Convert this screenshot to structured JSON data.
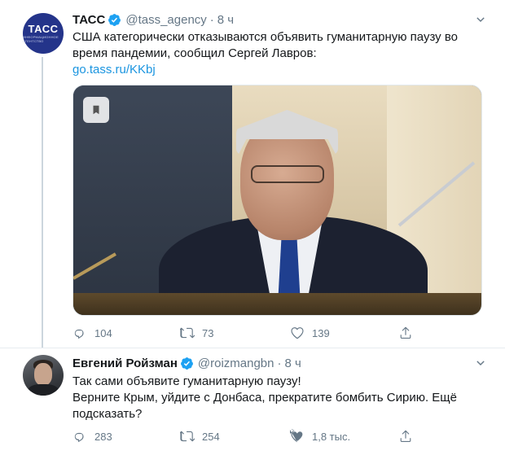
{
  "tweets": [
    {
      "author_name": "ТАСС",
      "handle": "@tass_agency",
      "separator": "·",
      "time": "8 ч",
      "avatar_text": "ТАСС",
      "avatar_subtext": "ИНФОРМАЦИОННОЕ АГЕНТСТВО",
      "text_lines": [
        "США категорически отказываются объявить гуманитарную паузу во",
        "время пандемии, сообщил Сергей Лавров:"
      ],
      "link": "go.tass.ru/KKbj",
      "replies": "104",
      "retweets": "73",
      "likes": "139"
    },
    {
      "author_name": "Евгений Ройзман",
      "handle": "@roizmangbn",
      "separator": "·",
      "time": "8 ч",
      "text_lines": [
        "Так сами объявите гуманитарную паузу!",
        "Верните Крым, уйдите с Донбаса, прекратите бомбить Сирию. Ещё",
        "подсказать?"
      ],
      "replies": "283",
      "retweets": "254",
      "likes": "1,8 тыс."
    }
  ],
  "colors": {
    "text": "#14171a",
    "secondary": "#657786",
    "link": "#1b95e0",
    "verified": "#1da1f2",
    "border": "#e6ecf0",
    "thread_line": "#ccd6dd"
  },
  "icons": [
    "verified-badge-icon",
    "caret-down-icon",
    "bookmark-icon",
    "reply-icon",
    "retweet-icon",
    "like-icon",
    "share-icon"
  ]
}
